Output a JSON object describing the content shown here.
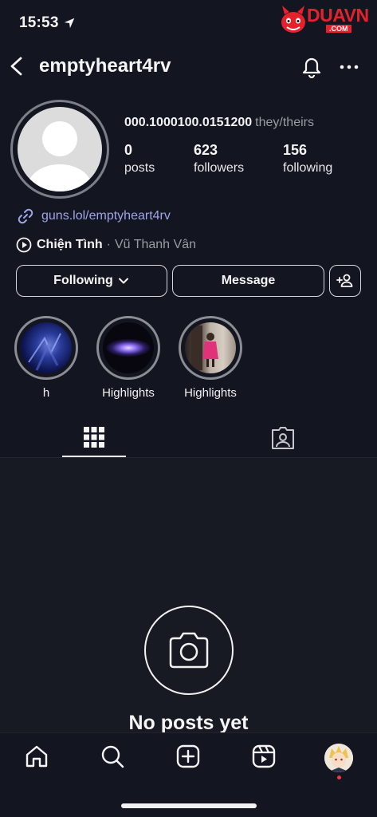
{
  "status_bar": {
    "time": "15:53"
  },
  "watermark": {
    "brand": "DUAVN",
    "suffix": ".COM"
  },
  "header": {
    "username": "emptyheart4rv"
  },
  "profile": {
    "full_name": "000.1000100.0151200",
    "pronouns": "they/theirs",
    "stats": [
      {
        "value": "0",
        "label": "posts"
      },
      {
        "value": "623",
        "label": "followers"
      },
      {
        "value": "156",
        "label": "following"
      }
    ],
    "link": "guns.lol/emptyheart4rv",
    "music": {
      "title": "Chiện Tình",
      "separator": "·",
      "artist": "Vũ Thanh Vân"
    }
  },
  "actions": {
    "following_label": "Following",
    "message_label": "Message"
  },
  "highlights": [
    {
      "label": "h"
    },
    {
      "label": "Highlights"
    },
    {
      "label": "Highlights"
    }
  ],
  "empty_state": {
    "text": "No posts yet"
  },
  "colors": {
    "background": "#131520",
    "link": "#9fa5e6",
    "notification_dot": "#ff3040"
  }
}
